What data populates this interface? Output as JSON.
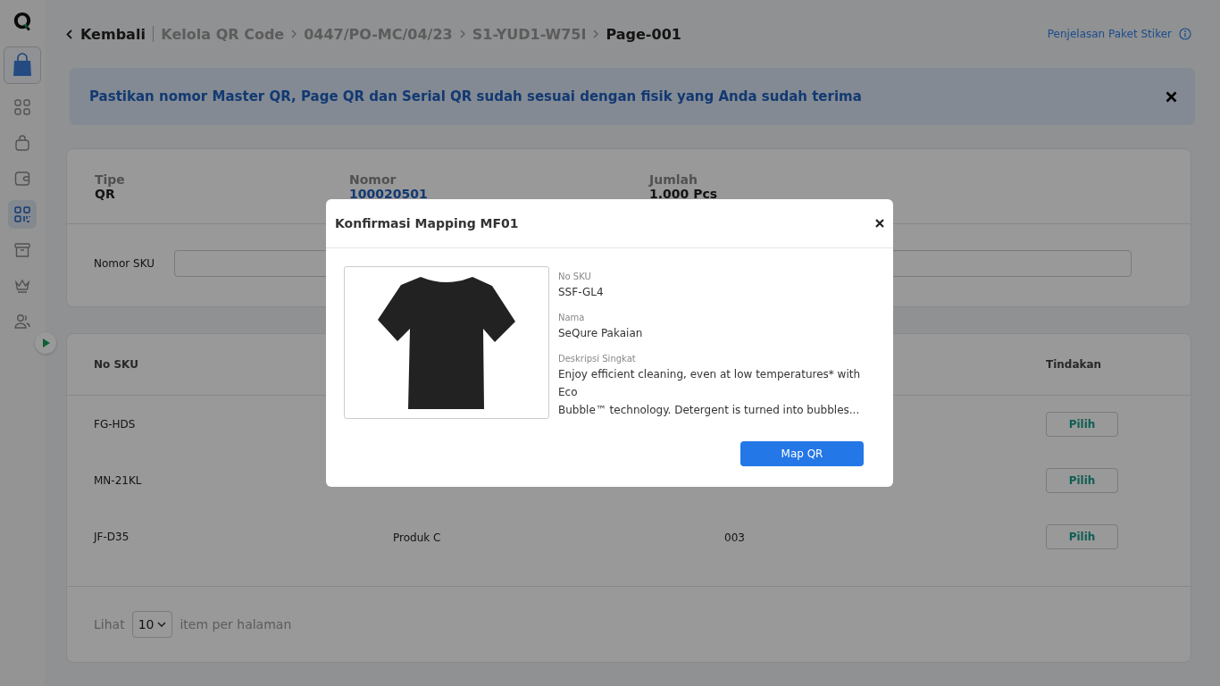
{
  "sidebar": {
    "items": [
      {
        "kind": "store",
        "selected": true
      },
      {
        "kind": "grid",
        "selected": false
      },
      {
        "kind": "bag",
        "selected": false
      },
      {
        "kind": "wallet",
        "selected": false
      },
      {
        "kind": "qr",
        "selected": true
      },
      {
        "kind": "archive",
        "selected": false
      },
      {
        "kind": "crown",
        "selected": false
      },
      {
        "kind": "users",
        "selected": false
      }
    ]
  },
  "breadcrumb": {
    "back": "Kembali",
    "items": [
      "Kelola QR Code",
      "0447/PO-MC/04/23",
      "S1-YUD1-W75I"
    ],
    "current": "Page-001"
  },
  "help_link": "Penjelasan Paket Stiker",
  "alert": {
    "text": "Pastikan nomor Master QR, Page QR dan Serial QR sudah sesuai dengan fisik yang Anda sudah terima"
  },
  "info": [
    {
      "label": "Tipe",
      "value": "QR",
      "kind": "plain"
    },
    {
      "label": "Nomor",
      "value": "100020501",
      "kind": "link"
    },
    {
      "label": "Jumlah",
      "value": "1.000 Pcs",
      "kind": "plain"
    }
  ],
  "sku_filter": {
    "label": "Nomor SKU"
  },
  "table": {
    "columns": [
      "No SKU",
      "Tindakan"
    ],
    "rows": [
      {
        "sku": "FG-HDS",
        "name": "",
        "code": "",
        "action": "Pilih"
      },
      {
        "sku": "MN-21KL",
        "name": "",
        "code": "",
        "action": "Pilih"
      },
      {
        "sku": "JF-D35",
        "name": "Produk C",
        "code": "003",
        "action": "Pilih"
      }
    ]
  },
  "pagination": {
    "prefix": "Lihat",
    "value": "10",
    "suffix": "item per halaman"
  },
  "modal": {
    "title": "Konfirmasi Mapping MF01",
    "fields": [
      {
        "label": "No SKU",
        "value": "SSF-GL4"
      },
      {
        "label": "Nama",
        "value": "SeQure Pakaian"
      },
      {
        "label": "Deskripsi Singkat",
        "value": "Enjoy efficient cleaning, even at low temperatures* with\nEco\nBubble™ technology. Detergent is turned into bubbles..."
      }
    ],
    "button": "Map QR"
  }
}
